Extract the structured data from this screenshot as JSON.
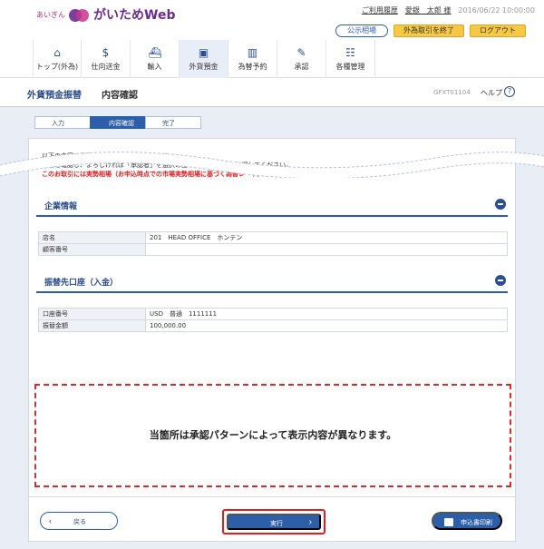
{
  "header": {
    "bank_name": "あいぎん",
    "app_name": "がいためWeb",
    "util_links": [
      "ご利用履歴",
      "愛銀　太郎 様"
    ],
    "datetime": "2016/06/22 10:00:00",
    "buttons": {
      "public_rate": "公示相場",
      "end_fx": "外為取引を終了",
      "logout": "ログアウト"
    }
  },
  "nav": {
    "items": [
      {
        "label": "トップ(外為)",
        "icon": "home-icon"
      },
      {
        "label": "仕向送金",
        "icon": "remit-icon"
      },
      {
        "label": "輸入",
        "icon": "ship-icon"
      },
      {
        "label": "外貨預金",
        "icon": "deposit-icon"
      },
      {
        "label": "為替予約",
        "icon": "chart-icon"
      },
      {
        "label": "承認",
        "icon": "approve-icon"
      },
      {
        "label": "各種管理",
        "icon": "manage-icon"
      }
    ]
  },
  "title": {
    "main": "外貨預金振替",
    "sub": "内容確認",
    "code": "GFXT01104",
    "help": "ヘルプ"
  },
  "steps": [
    "入力",
    "内容確認",
    "完了"
  ],
  "intro": {
    "line1": "以下の内容で外貨預金振替の依頼を行います。",
    "line2": "内容を確認し、よろしければ「承認者」を選択の上、「実行」ボタンを押してください。",
    "line3": "このお取引には実勢相場（お申込時点での市場実勢相場に基づく為替レート）を適用します。"
  },
  "company_section": {
    "title": "企業情報",
    "rows": [
      {
        "key": "店名",
        "value": "201　HEAD OFFICE　ホンテン"
      },
      {
        "key": "顧客番号",
        "value": ""
      }
    ]
  },
  "transfer_section": {
    "title": "振替先口座（入金）",
    "rows": [
      {
        "key": "口座番号",
        "value": "USD　普通　1111111"
      },
      {
        "key": "振替金額",
        "value": "100,000.00"
      }
    ]
  },
  "note": "当箇所は承認パターンによって表示内容が異なります。",
  "actions": {
    "back": "戻る",
    "execute": "実行",
    "print": "申込書印刷"
  }
}
